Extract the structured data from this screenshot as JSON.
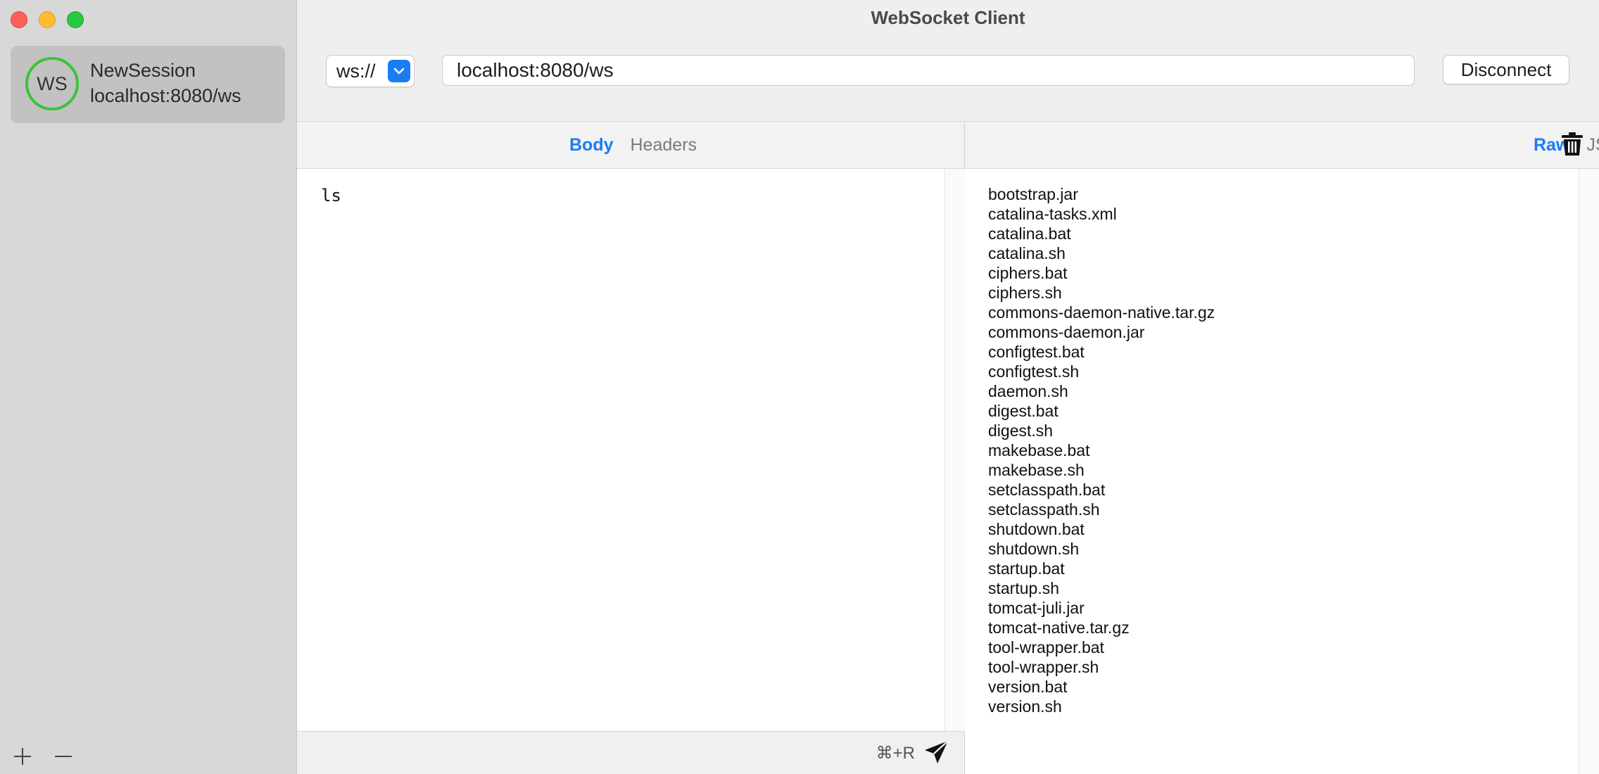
{
  "window": {
    "title": "WebSocket Client"
  },
  "sidebar": {
    "sessions": [
      {
        "avatar": "WS",
        "name": "NewSession",
        "url": "localhost:8080/ws",
        "status_color": "#3ac43a"
      }
    ],
    "footer": {
      "add_icon": "plus-icon",
      "remove_icon": "minus-icon"
    }
  },
  "toolbar": {
    "scheme": "ws://",
    "url": "localhost:8080/ws",
    "disconnect_label": "Disconnect"
  },
  "request": {
    "tabs": [
      {
        "label": "Body",
        "active": true
      },
      {
        "label": "Headers",
        "active": false
      }
    ],
    "body": "ls",
    "shortcut": "⌘+R"
  },
  "response": {
    "tabs": [
      {
        "label": "Raw",
        "active": true
      },
      {
        "label": "JSON",
        "active": false
      }
    ],
    "lines": [
      "bootstrap.jar",
      "catalina-tasks.xml",
      "catalina.bat",
      "catalina.sh",
      "ciphers.bat",
      "ciphers.sh",
      "commons-daemon-native.tar.gz",
      "commons-daemon.jar",
      "configtest.bat",
      "configtest.sh",
      "daemon.sh",
      "digest.bat",
      "digest.sh",
      "makebase.bat",
      "makebase.sh",
      "setclasspath.bat",
      "setclasspath.sh",
      "shutdown.bat",
      "shutdown.sh",
      "startup.bat",
      "startup.sh",
      "tomcat-juli.jar",
      "tomcat-native.tar.gz",
      "tool-wrapper.bat",
      "tool-wrapper.sh",
      "version.bat",
      "version.sh"
    ]
  },
  "colors": {
    "accent": "#1a7cf5",
    "connected": "#3ac43a"
  }
}
